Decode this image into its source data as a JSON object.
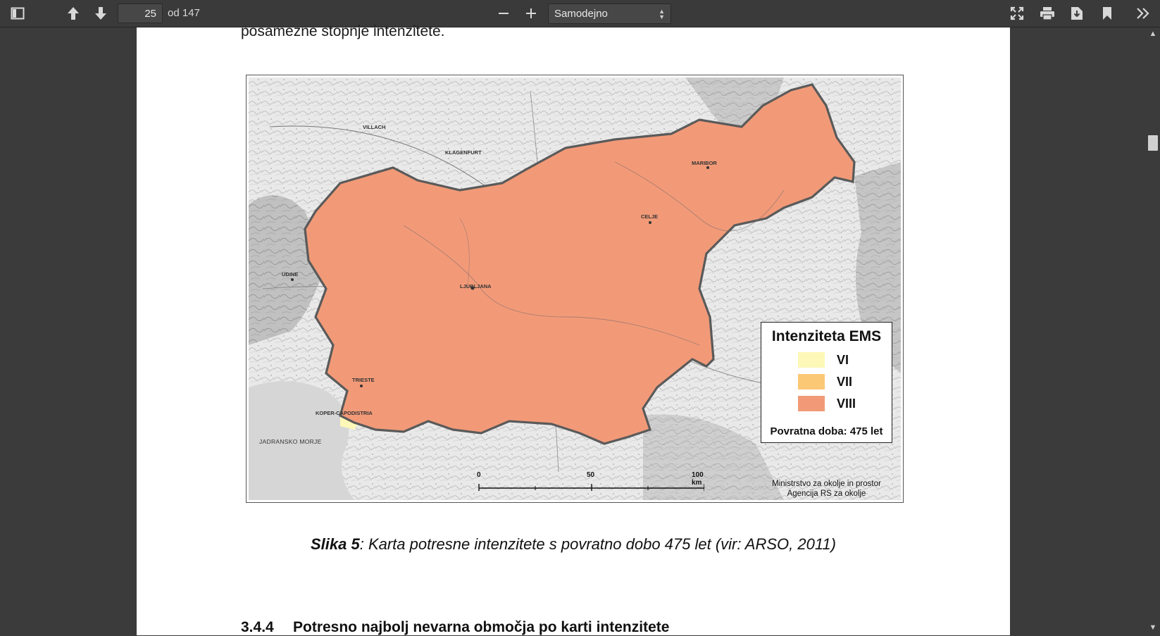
{
  "toolbar": {
    "page_number": "25",
    "page_count_label": "od 147",
    "zoom_value": "Samodejno"
  },
  "icons": {
    "sidebar": "sidebar-toggle-icon",
    "prev": "arrow-up-icon",
    "next": "arrow-down-icon",
    "zoom_out": "minus-icon",
    "zoom_in": "plus-icon",
    "presentation": "fullscreen-icon",
    "print": "printer-icon",
    "download": "download-icon",
    "bookmark": "bookmark-icon",
    "tools": "double-chevron-right-icon"
  },
  "document": {
    "prev_line": "posamezne stopnje intenzitete.",
    "figure": {
      "legend_title": "Intenziteta EMS",
      "legend_items": [
        {
          "label": "VI",
          "color": "#fdf8b8"
        },
        {
          "label": "VII",
          "color": "#fbc875"
        },
        {
          "label": "VIII",
          "color": "#f29a78"
        }
      ],
      "legend_footer": "Povratna doba: 475 let",
      "credit_line1": "Ministrstvo za okolje in prostor",
      "credit_line2": "Agencija RS za okolje",
      "scale_0": "0",
      "scale_50": "50",
      "scale_100": "100 km",
      "sea_label": "JADRANSKO MORJE",
      "cities": {
        "ljubljana": "LJUBLJANA",
        "maribor": "MARIBOR",
        "trieste": "TRIESTE",
        "villach": "VILLACH",
        "klagenfurt": "KLAGENFURT",
        "udine": "UDINE",
        "celje": "CELJE",
        "koper": "KOPER-CAPODISTRIA"
      }
    },
    "caption_bold": "Slika 5",
    "caption_rest": ": Karta potresne intenzitete s povratno dobo 475 let (vir: ARSO, 2011)",
    "heading_number": "3.4.4",
    "heading_text": "Potresno najbolj nevarna območja po karti intenzitete"
  }
}
